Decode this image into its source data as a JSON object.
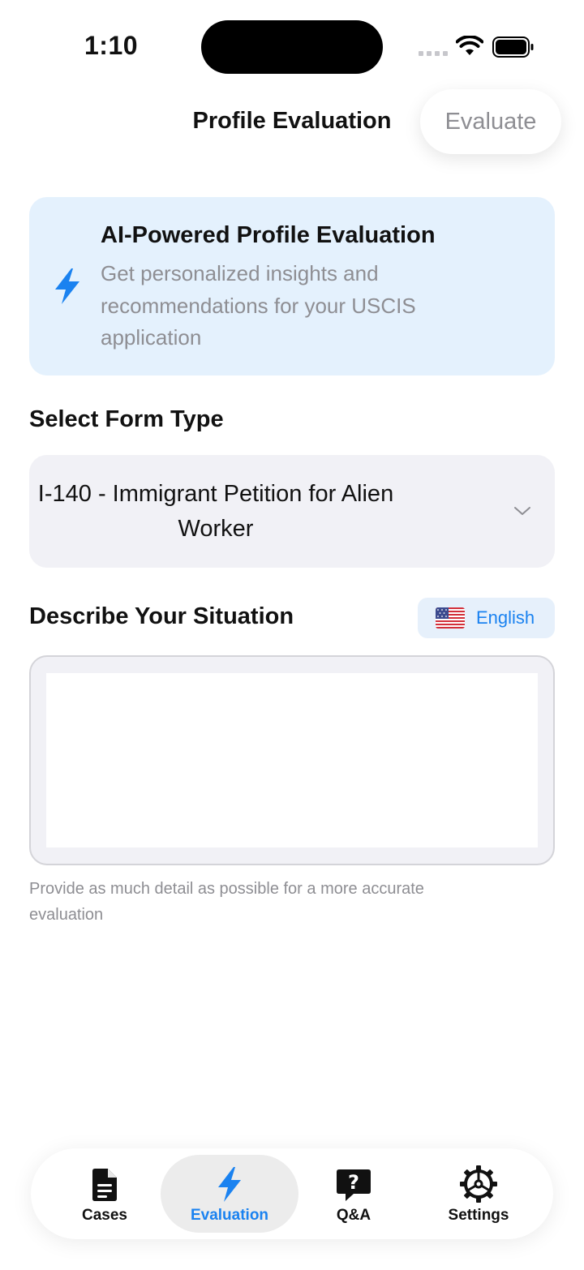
{
  "status_bar": {
    "time": "1:10"
  },
  "header": {
    "title": "Profile Evaluation",
    "evaluate_label": "Evaluate"
  },
  "banner": {
    "title": "AI-Powered Profile Evaluation",
    "description": "Get personalized insights and recommendations for your USCIS application",
    "icon": "bolt-icon"
  },
  "form_type": {
    "label": "Select Form Type",
    "selected": "I-140 - Immigrant Petition for Alien Worker"
  },
  "situation": {
    "label": "Describe Your Situation",
    "language": "English",
    "value": "",
    "hint": "Provide as much detail as possible for a more accurate evaluation"
  },
  "tabs": [
    {
      "label": "Cases",
      "icon": "document-icon",
      "active": false
    },
    {
      "label": "Evaluation",
      "icon": "bolt-icon",
      "active": true
    },
    {
      "label": "Q&A",
      "icon": "question-bubble-icon",
      "active": false
    },
    {
      "label": "Settings",
      "icon": "gear-icon",
      "active": false
    }
  ],
  "colors": {
    "accent": "#1a82f0",
    "banner_bg": "#e4f1fd",
    "field_bg": "#f1f1f6",
    "muted_text": "#8e8e93"
  }
}
